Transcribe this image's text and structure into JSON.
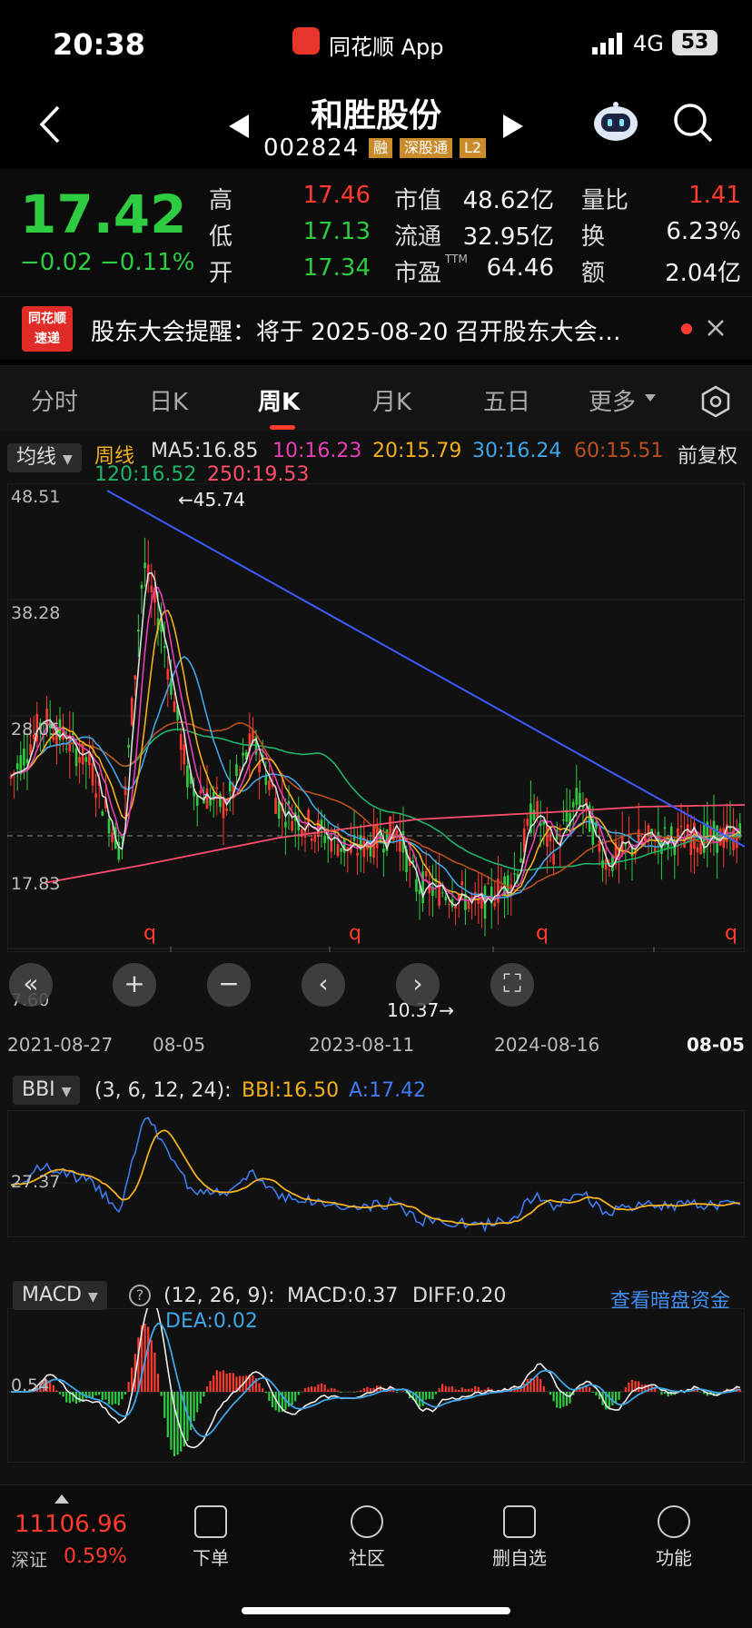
{
  "status_bar": {
    "time": "20:38",
    "app_name": "同花顺 App",
    "network": "4G",
    "battery": "53"
  },
  "header": {
    "stock_name": "和胜股份",
    "stock_code": "002824",
    "tags": [
      "融",
      "深股通",
      "L2"
    ]
  },
  "quote": {
    "price": "17.42",
    "change": "−0.02",
    "change_pct": "−0.11%",
    "high_label": "高",
    "high": "17.46",
    "low_label": "低",
    "low": "17.13",
    "open_label": "开",
    "open": "17.34",
    "mktcap_label": "市值",
    "mktcap": "48.62亿",
    "float_label": "流通",
    "float": "32.95亿",
    "pe_label": "市盈",
    "pe_sup": "TTM",
    "pe": "64.46",
    "vol_ratio_label": "量比",
    "vol_ratio": "1.41",
    "turnover_label": "换",
    "turnover": "6.23%",
    "amount_label": "额",
    "amount": "2.04亿"
  },
  "notice": {
    "logo_line1": "同花顺",
    "logo_line2": "速递",
    "text": "股东大会提醒：将于 2025-08-20 召开股东大会…"
  },
  "tabs": [
    "分时",
    "日K",
    "周K",
    "月K",
    "五日",
    "更多"
  ],
  "active_tab": "周K",
  "main_chart": {
    "indicator": "均线",
    "period": "周线",
    "ma_items": [
      {
        "label": "MA5:16.85",
        "color": "#dddddd"
      },
      {
        "label": "10:16.23",
        "color": "#e83fb6"
      },
      {
        "label": "20:15.79",
        "color": "#f2b01e"
      },
      {
        "label": "30:16.24",
        "color": "#3ea6e8"
      },
      {
        "label": "60:15.51",
        "color": "#b8501e"
      },
      {
        "label": "120:16.52",
        "color": "#1fb36a"
      },
      {
        "label": "250:19.53",
        "color": "#ff4d6d"
      }
    ],
    "adjust": "前复权",
    "y_labels": [
      "48.51",
      "38.28",
      "28.05",
      "17.83",
      "7.60"
    ],
    "max_note": "←45.74",
    "min_note": "10.37→",
    "x_labels": [
      "2021-08-27",
      "08-05",
      "2023-08-11",
      "2024-08-16",
      "08-05"
    ]
  },
  "bbi": {
    "name": "BBI",
    "params": "(3, 6, 12, 24):",
    "bbi_label": "BBI:16.50",
    "a_label": "A:17.42",
    "y_label": "27.37"
  },
  "macd": {
    "name": "MACD",
    "params": "(12, 26, 9):",
    "macd_label": "MACD:0.37",
    "diff_label": "DIFF:0.20",
    "dea_label": "DEA:0.02",
    "link": "查看暗盘资金",
    "y_label": "0.54"
  },
  "bottom_nav": {
    "index_value": "11106.96",
    "index_name": "深证",
    "index_pct": "0.59%",
    "items": [
      "下单",
      "社区",
      "删自选",
      "功能"
    ]
  },
  "chart_data": {
    "type": "line",
    "title": "",
    "xlabel": "",
    "ylabel": "",
    "ylim": [
      7.6,
      48.51
    ],
    "x": [
      "2021-08-27",
      "2022-08-05",
      "2023-08-11",
      "2024-08-16",
      "2025-08-05"
    ],
    "series": [
      {
        "name": "MA5",
        "values": [
          22,
          30,
          21,
          15,
          17
        ]
      },
      {
        "name": "250",
        "values": [
          9,
          13,
          17,
          18,
          19.5
        ]
      }
    ]
  }
}
